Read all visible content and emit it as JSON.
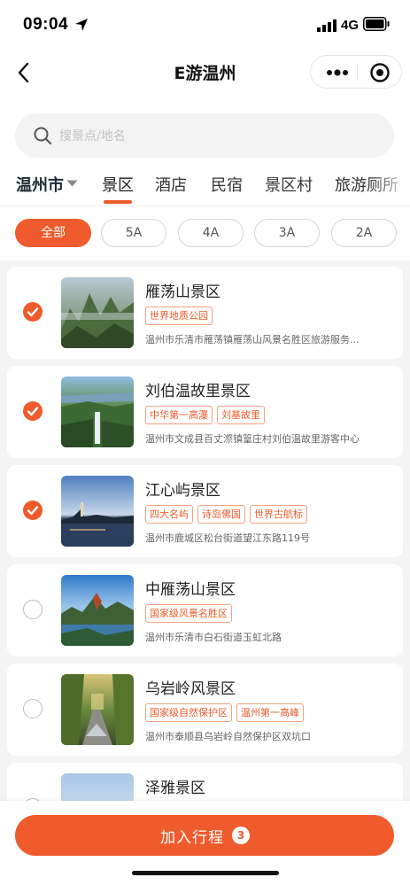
{
  "status_bar": {
    "time": "09:04",
    "network": "4G",
    "icons": [
      "location-arrow-icon",
      "signal-icon",
      "battery-icon"
    ]
  },
  "nav": {
    "title": "E游温州",
    "back_icon": "chevron-left-icon",
    "more_icon": "more-dots-icon",
    "close_icon": "target-close-icon"
  },
  "search": {
    "placeholder": "搜景点/地名",
    "icon": "search-icon"
  },
  "tabs": {
    "city": "温州市",
    "items": [
      {
        "label": "景区",
        "active": true
      },
      {
        "label": "酒店",
        "active": false
      },
      {
        "label": "民宿",
        "active": false
      },
      {
        "label": "景区村",
        "active": false
      },
      {
        "label": "旅游厕所",
        "active": false
      }
    ]
  },
  "filters": [
    {
      "label": "全部",
      "active": true
    },
    {
      "label": "5A",
      "active": false
    },
    {
      "label": "4A",
      "active": false
    },
    {
      "label": "3A",
      "active": false
    },
    {
      "label": "2A",
      "active": false
    }
  ],
  "scenic_spots": [
    {
      "name": "雁荡山景区",
      "checked": true,
      "tags": [
        "世界地质公园"
      ],
      "address": "温州市乐清市雁荡镇雁荡山风景名胜区旅游服务..."
    },
    {
      "name": "刘伯温故里景区",
      "checked": true,
      "tags": [
        "中华第一高瀑",
        "刘基故里"
      ],
      "address": "温州市文成县百丈漈镇篁庄村刘伯温故里游客中心"
    },
    {
      "name": "江心屿景区",
      "checked": true,
      "tags": [
        "四大名屿",
        "诗岛佛国",
        "世界古航标"
      ],
      "address": "温州市鹿城区松台街道望江东路119号"
    },
    {
      "name": "中雁荡山景区",
      "checked": false,
      "tags": [
        "国家级风景名胜区"
      ],
      "address": "温州市乐清市白石街道玉虹北路"
    },
    {
      "name": "乌岩岭风景区",
      "checked": false,
      "tags": [
        "国家级自然保护区",
        "温州第一高峰"
      ],
      "address": "温州市泰顺县乌岩岭自然保护区双坑口"
    },
    {
      "name": "泽雅景区",
      "checked": false,
      "tags": [],
      "address": ""
    }
  ],
  "cta": {
    "label": "加入行程",
    "count": "3"
  },
  "colors": {
    "accent": "#ef5b2c",
    "tag_border": "#f3a37f",
    "background": "#f4f4f4"
  }
}
